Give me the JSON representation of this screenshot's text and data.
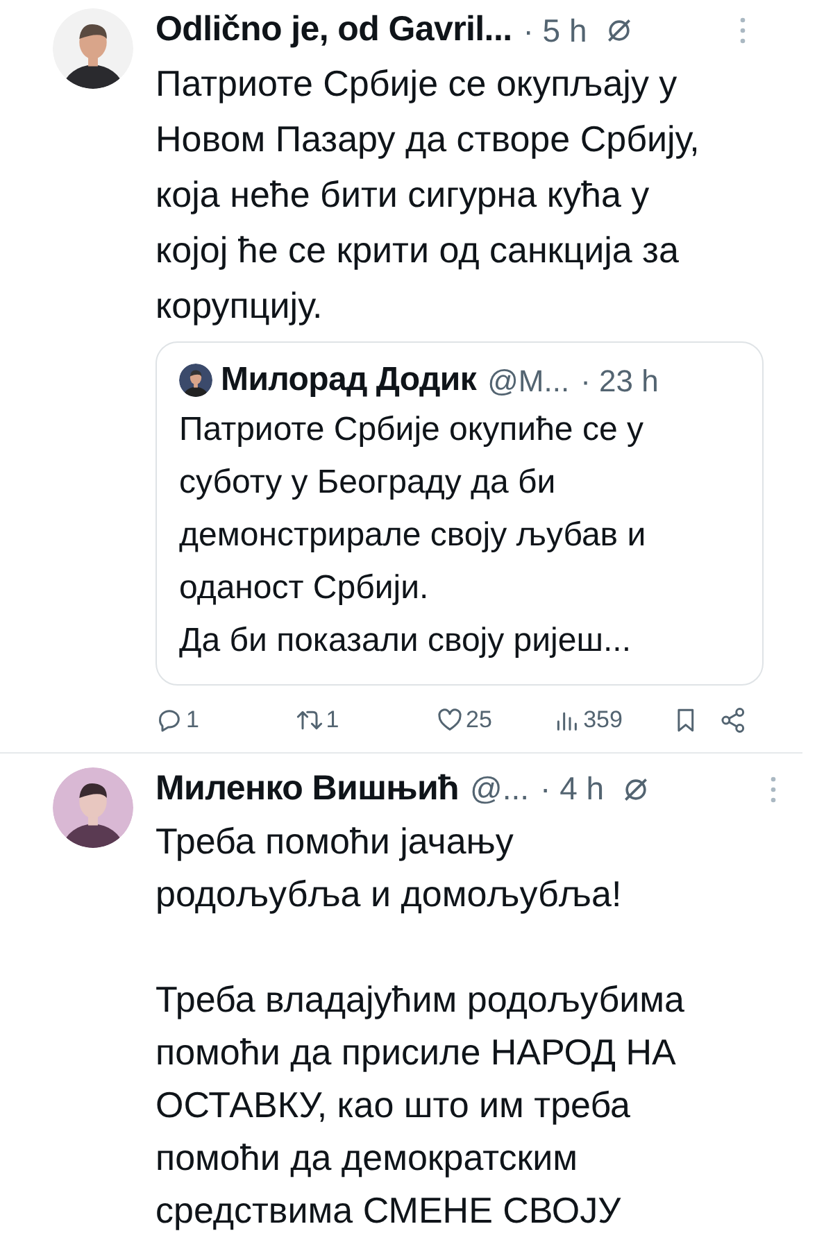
{
  "tweets": [
    {
      "author": "Odlično je, od Gavril...",
      "time": "· 5 h",
      "text": "Патриоте Србије се окупљају у\nНовом Пазару да створе Србију,\nкоја неће бити сигурна кућа у\nкојој ће се крити од санкција за\nкорупцију.",
      "quote": {
        "author": "Милорад Додик",
        "handle": "@М...",
        "time": "· 23 h",
        "text": "Патриоте Србије окупиће се у\nсуботу у Београду да би\nдемонстрирале своју љубав и\nоданост Србији.\nДа би показали своју ријеш..."
      },
      "actions": {
        "replies": "1",
        "reposts": "1",
        "likes": "25",
        "views": "359"
      }
    },
    {
      "author": "Миленко Вишњић",
      "handle": "@...",
      "time": "· 4 h",
      "text": "Треба помоћи јачању\nродољубља и домољубља!\n\nТреба владајућим родољубима\nпомоћи да присиле НАРОД НА\nОСТАВКУ, као што им треба\nпомоћи да демократским\nсредствима СМЕНЕ СВОЈУ"
    }
  ]
}
